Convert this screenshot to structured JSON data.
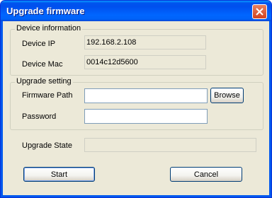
{
  "window": {
    "title": "Upgrade firmware",
    "close_icon": "close-icon"
  },
  "device_info": {
    "group_label": "Device information",
    "ip_label": "Device IP",
    "ip_value": "192.168.2.108",
    "mac_label": "Device Mac",
    "mac_value": "0014c12d5600"
  },
  "upgrade_setting": {
    "group_label": "Upgrade setting",
    "firmware_path_label": "Firmware Path",
    "firmware_path_value": "",
    "browse_label": "Browse",
    "password_label": "Password",
    "password_value": ""
  },
  "upgrade_state": {
    "label": "Upgrade State",
    "value": ""
  },
  "buttons": {
    "start": "Start",
    "cancel": "Cancel"
  }
}
